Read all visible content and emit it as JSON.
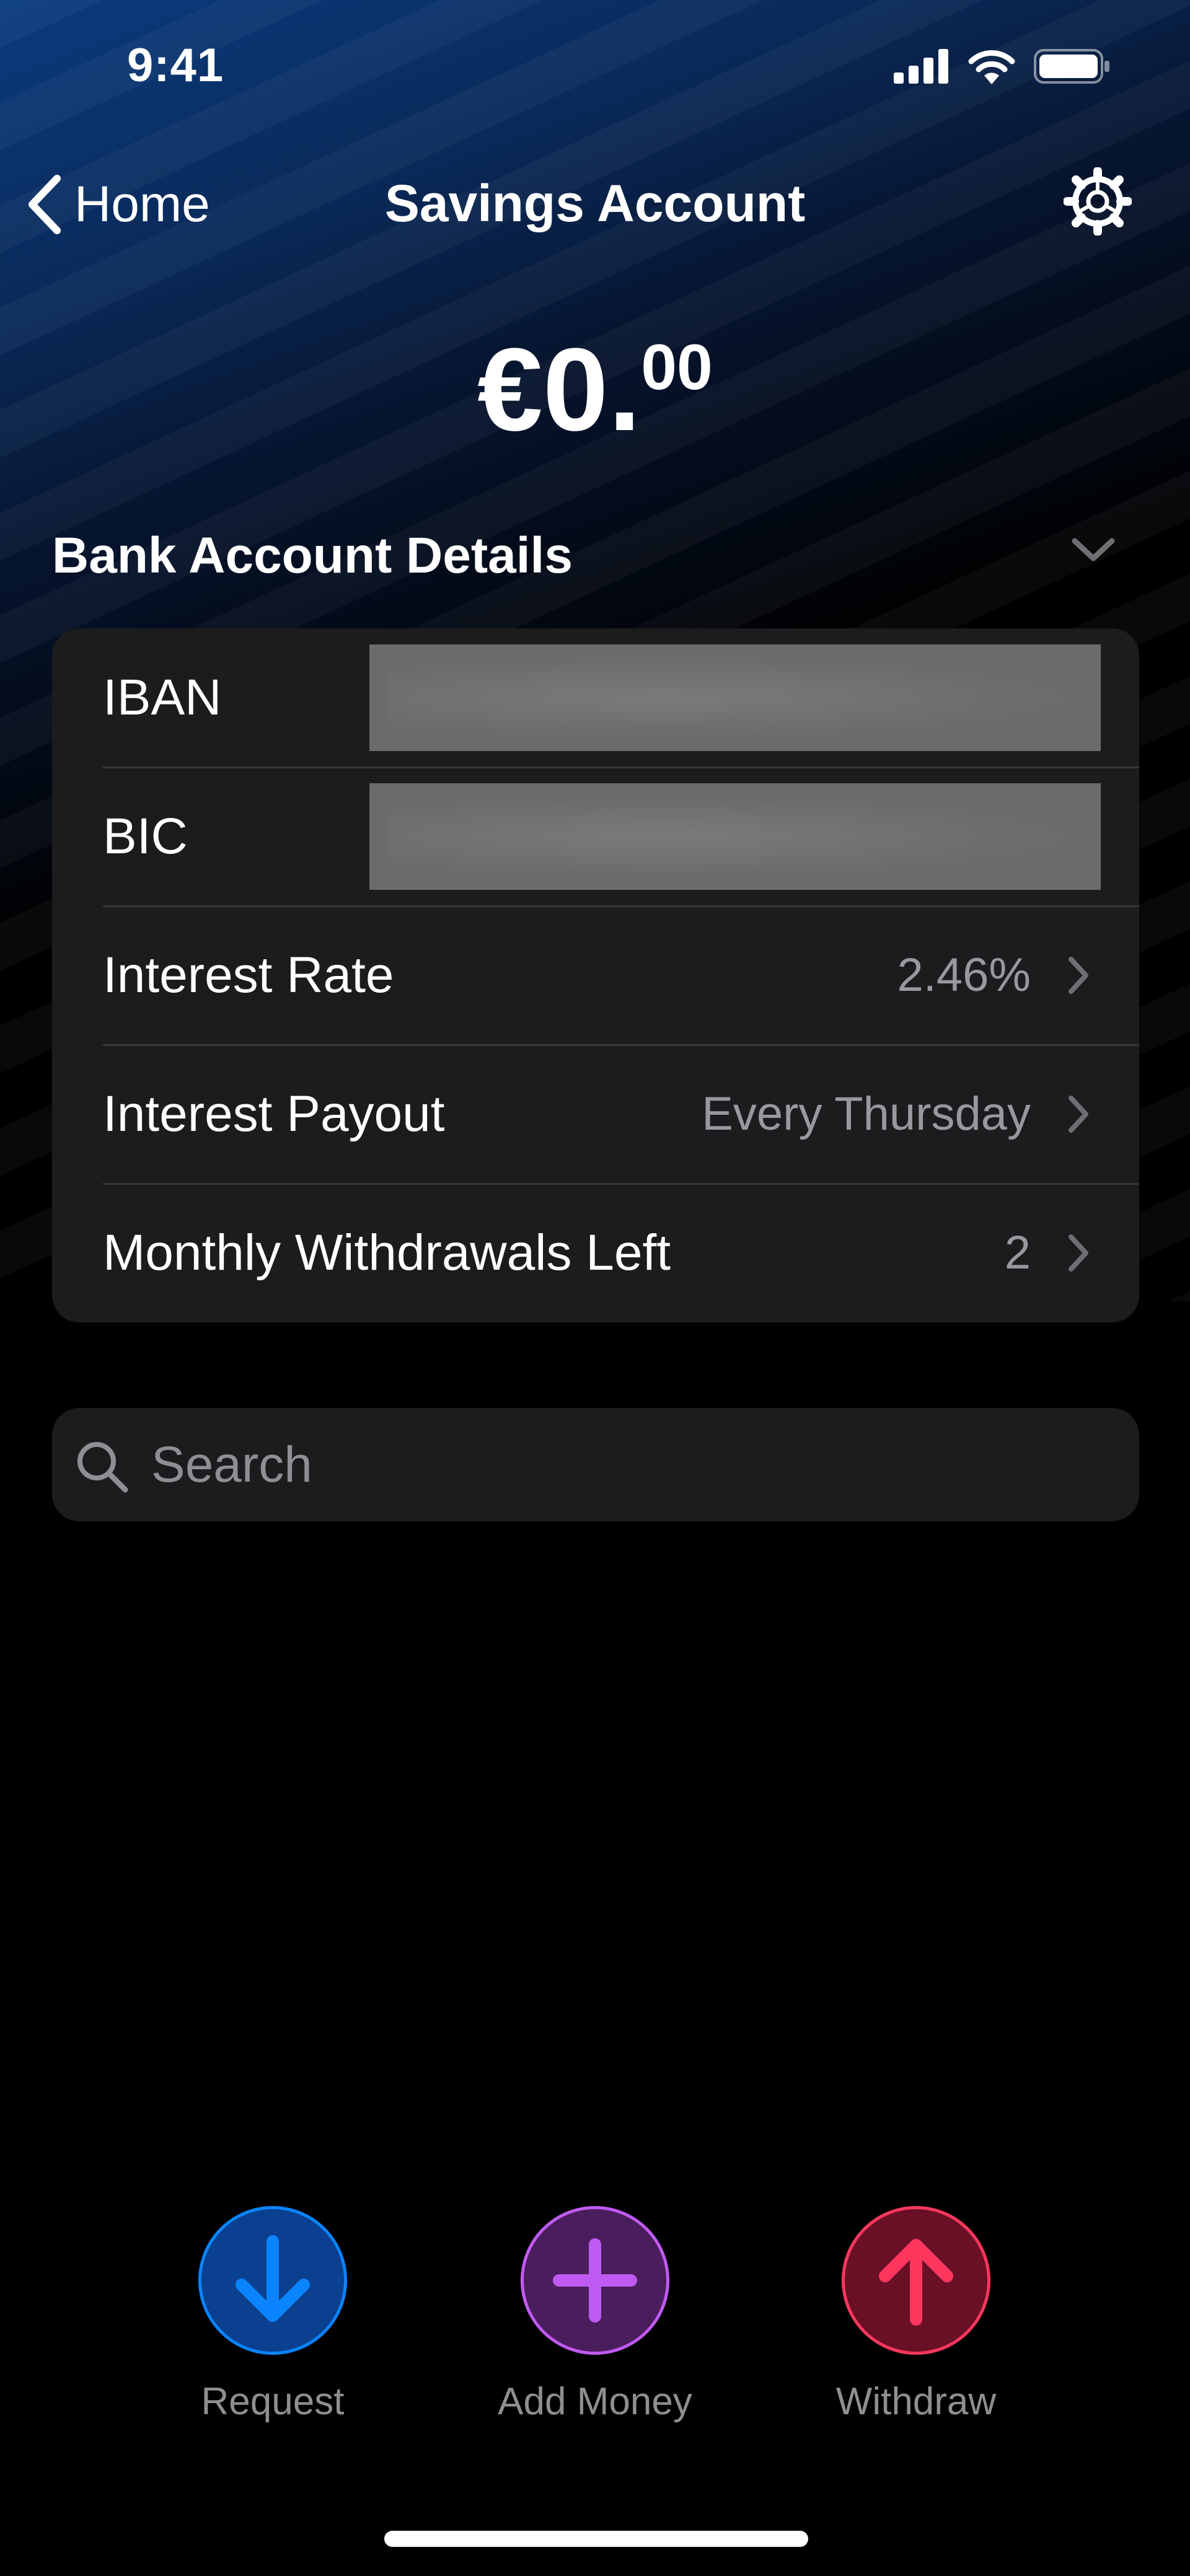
{
  "status_bar": {
    "time": "9:41"
  },
  "nav": {
    "back_label": "Home",
    "title": "Savings Account"
  },
  "balance": {
    "currency": "€",
    "whole": "0",
    "decimal": ".",
    "cents": "00"
  },
  "details": {
    "header": "Bank Account Details",
    "rows": [
      {
        "label": "IBAN",
        "value": ""
      },
      {
        "label": "BIC",
        "value": ""
      },
      {
        "label": "Interest Rate",
        "value": "2.46%"
      },
      {
        "label": "Interest Payout",
        "value": "Every Thursday"
      },
      {
        "label": "Monthly Withdrawals Left",
        "value": "2"
      }
    ]
  },
  "search": {
    "placeholder": "Search"
  },
  "actions": [
    {
      "label": "Request",
      "color": "#0a84ff",
      "icon": "arrow-down-icon"
    },
    {
      "label": "Add Money",
      "color": "#bf5af2",
      "icon": "plus-icon"
    },
    {
      "label": "Withdraw",
      "color": "#ff375f",
      "icon": "arrow-up-icon"
    }
  ]
}
